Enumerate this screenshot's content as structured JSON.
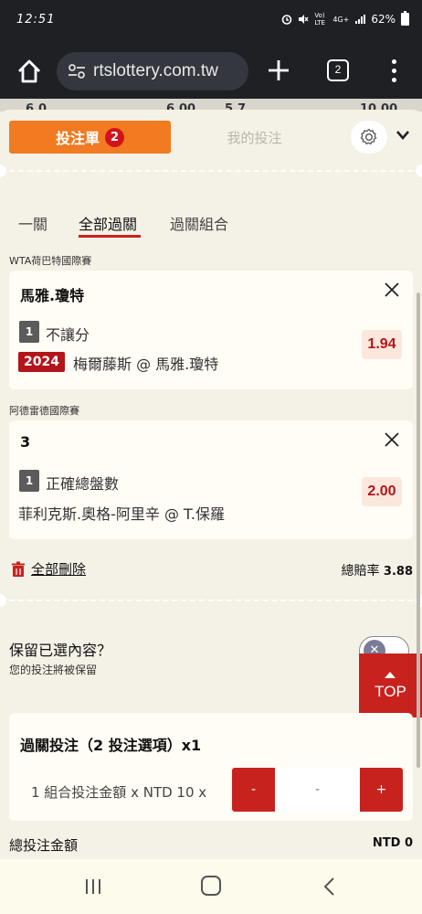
{
  "status_bar": {
    "time": "12:51",
    "signal_text": "Vo) LTE",
    "network": "4G+",
    "battery": "62%"
  },
  "browser": {
    "url": "rtslottery.com.tw",
    "tab_count": "2"
  },
  "peek": {
    "left_num": "6.0",
    "left_odds": "6.00",
    "right_num": "5.7",
    "right_odds": "10.00"
  },
  "header": {
    "betslip_label": "投注單",
    "betslip_count": "2",
    "mybets_label": "我的投注"
  },
  "subtabs": [
    {
      "label": "一關"
    },
    {
      "label": "全部過關"
    },
    {
      "label": "過關組合"
    }
  ],
  "bets": [
    {
      "league": "WTA荷巴特國際賽",
      "title": "馬雅.瓊特",
      "selection_index": "1",
      "market": "不讓分",
      "event_code": "2024",
      "event": "梅爾藤斯 @ 馬雅.瓊特",
      "odds": "1.94"
    },
    {
      "league": "阿德雷德國際賽",
      "title": "3",
      "selection_index": "1",
      "market": "正確總盤數",
      "event": "菲利克斯.奧格-阿里辛 @ T.保羅",
      "odds": "2.00"
    }
  ],
  "actions": {
    "delete_all": "全部刪除",
    "total_odds_label": "總賠率",
    "total_odds_value": "3.88"
  },
  "keep": {
    "title": "保留已選內容？",
    "subtitle": "您的投注將被保留",
    "toggle_glyph": "✕"
  },
  "top_button": {
    "label": "TOP"
  },
  "parlay": {
    "title": "過關投注（2 投注選項）x1",
    "stake_label": "1 組合投注金額 x NTD 10 x",
    "minus": "-",
    "plus": "+",
    "stake_placeholder": "-"
  },
  "totals": {
    "label": "總投注金額",
    "value": "NTD 0"
  },
  "colors": {
    "accent_orange": "#f27a20",
    "brand_red": "#c8221e",
    "odds_red": "#b4151c",
    "background": "#f4f1e6"
  }
}
